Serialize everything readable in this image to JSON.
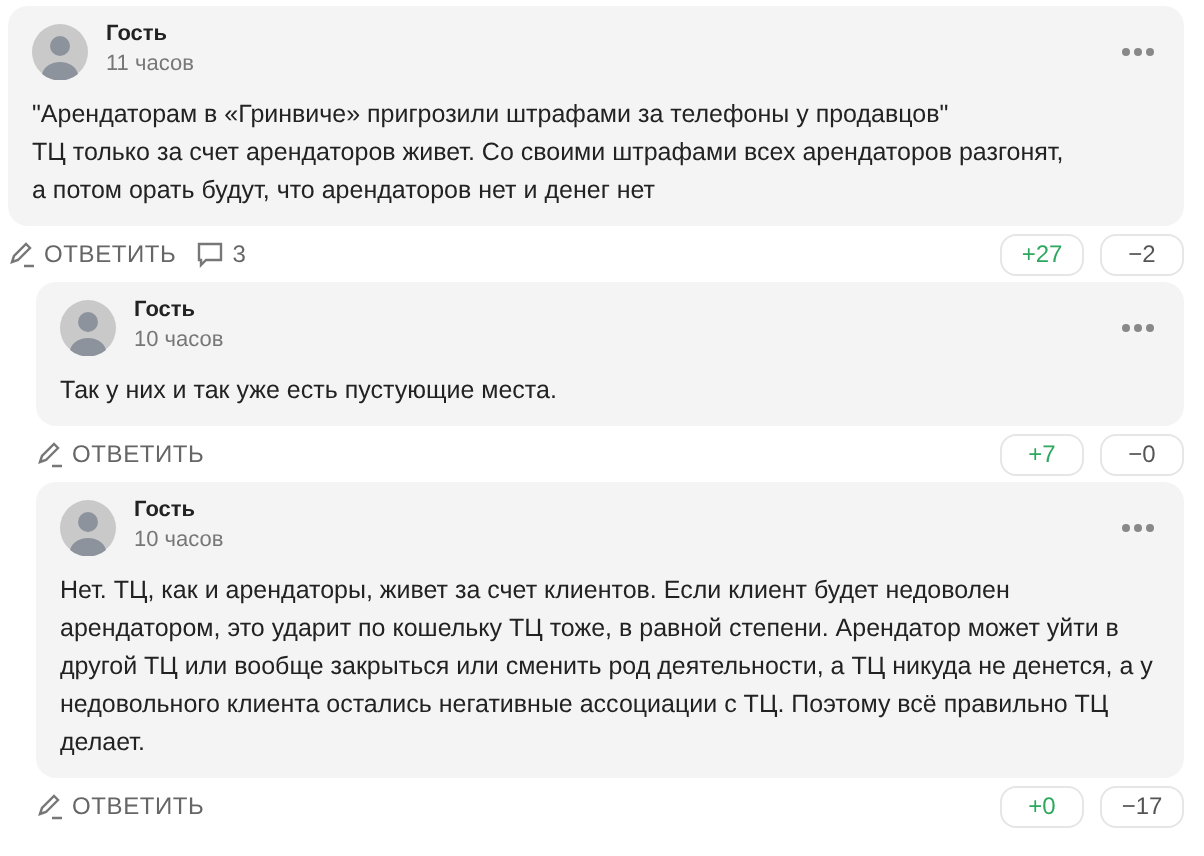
{
  "comments": [
    {
      "author": "Гость",
      "time": "11 часов",
      "text": "\"Арендаторам в «Гринвиче» пригрозили штрафами за телефоны у продавцов\"\nТЦ только за счет арендаторов живет. Со своими штрафами всех арендаторов разгонят,\nа потом орать будут, что арендаторов нет и денег нет",
      "reply_label": "ОТВЕТИТЬ",
      "replies_count": "3",
      "upvotes": "+27",
      "downvotes": "−2",
      "children": [
        {
          "author": "Гость",
          "time": "10 часов",
          "text": "Так у них и так уже есть пустующие места.",
          "reply_label": "ОТВЕТИТЬ",
          "upvotes": "+7",
          "downvotes": "−0"
        },
        {
          "author": "Гость",
          "time": "10 часов",
          "text": "Нет. ТЦ, как и арендаторы, живет за счет клиентов. Если клиент будет недоволен арендатором, это ударит по кошельку ТЦ тоже, в равной степени. Арендатор может уйти в другой ТЦ или вообще закрыться или сменить род деятельности, а ТЦ никуда не денется, а у недовольного клиента остались негативные ассоциации с ТЦ. Поэтому всё правильно ТЦ делает.",
          "reply_label": "ОТВЕТИТЬ",
          "upvotes": "+0",
          "downvotes": "−17"
        }
      ]
    }
  ]
}
